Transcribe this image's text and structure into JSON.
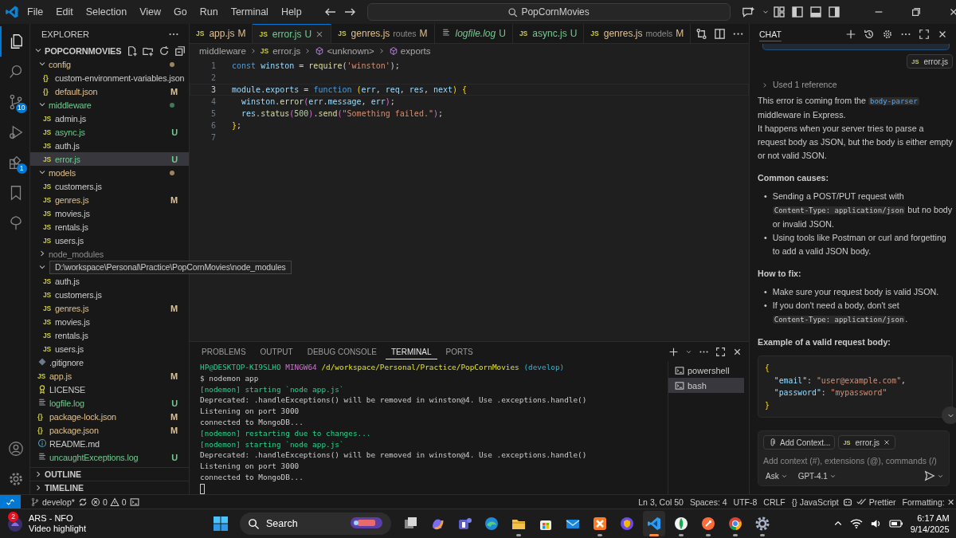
{
  "titlebar": {
    "menu": [
      "File",
      "Edit",
      "Selection",
      "View",
      "Go",
      "Run",
      "Terminal",
      "Help"
    ],
    "search": "PopCornMovies"
  },
  "activity_bar": {
    "items": [
      {
        "kind": "files",
        "selected": true
      },
      {
        "kind": "search",
        "selected": false
      },
      {
        "kind": "source-control",
        "selected": false,
        "badge": "10"
      },
      {
        "kind": "run",
        "selected": false
      },
      {
        "kind": "extensions",
        "selected": false,
        "badge": "1"
      },
      {
        "kind": "bookmark",
        "selected": false
      },
      {
        "kind": "tree",
        "selected": false
      }
    ],
    "bottom": [
      {
        "kind": "account"
      },
      {
        "kind": "settings"
      }
    ]
  },
  "explorer": {
    "title": "EXPLORER",
    "root": {
      "label": "POPCORNMOVIES",
      "expanded": true,
      "children": [
        {
          "kind": "folder",
          "label": "config",
          "modified": true,
          "untracked": false,
          "ignored": false,
          "expanded": true,
          "selected": false,
          "children": [
            {
              "kind": "json",
              "icon": "{}",
              "label": "custom-environment-variables.json",
              "modified": false,
              "untracked": false,
              "selected": false
            },
            {
              "kind": "json",
              "icon": "{}",
              "label": "default.json",
              "modified": true,
              "untracked": false,
              "badge": "M",
              "selected": false
            }
          ]
        },
        {
          "kind": "folder",
          "label": "middleware",
          "modified": false,
          "untracked": true,
          "ignored": false,
          "expanded": true,
          "selected": false,
          "children": [
            {
              "kind": "js",
              "icon": "JS",
              "label": "admin.js",
              "modified": false,
              "untracked": false,
              "selected": false
            },
            {
              "kind": "js",
              "icon": "JS",
              "label": "async.js",
              "modified": false,
              "untracked": true,
              "badge": "U",
              "selected": false
            },
            {
              "kind": "js",
              "icon": "JS",
              "label": "auth.js",
              "modified": false,
              "untracked": false,
              "selected": false
            },
            {
              "kind": "js",
              "icon": "JS",
              "label": "error.js",
              "modified": false,
              "untracked": true,
              "badge": "U",
              "selected": true
            }
          ]
        },
        {
          "kind": "folder",
          "label": "models",
          "modified": true,
          "untracked": false,
          "ignored": false,
          "expanded": true,
          "selected": false,
          "children": [
            {
              "kind": "js",
              "icon": "JS",
              "label": "customers.js",
              "modified": false,
              "untracked": false,
              "selected": false
            },
            {
              "kind": "js",
              "icon": "JS",
              "label": "genres.js",
              "modified": true,
              "untracked": false,
              "badge": "M",
              "selected": false
            },
            {
              "kind": "js",
              "icon": "JS",
              "label": "movies.js",
              "modified": false,
              "untracked": false,
              "selected": false
            },
            {
              "kind": "js",
              "icon": "JS",
              "label": "rentals.js",
              "modified": false,
              "untracked": false,
              "selected": false
            },
            {
              "kind": "js",
              "icon": "JS",
              "label": "users.js",
              "modified": false,
              "untracked": false,
              "selected": false
            }
          ]
        },
        {
          "kind": "folder",
          "label": "node_modules",
          "modified": false,
          "untracked": false,
          "ignored": true,
          "expanded": false,
          "selected": false
        },
        {
          "kind": "folder",
          "tooltip": "D:\\workspace\\Personal\\Practice\\PopCornMovies\\node_modules",
          "modified": false,
          "untracked": false,
          "ignored": false,
          "expanded": true,
          "selected": false,
          "children": [
            {
              "kind": "js",
              "icon": "JS",
              "label": "auth.js",
              "modified": false,
              "untracked": false,
              "selected": false
            },
            {
              "kind": "js",
              "icon": "JS",
              "label": "customers.js",
              "modified": false,
              "untracked": false,
              "selected": false
            },
            {
              "kind": "js",
              "icon": "JS",
              "label": "genres.js",
              "modified": true,
              "untracked": false,
              "badge": "M",
              "selected": false
            },
            {
              "kind": "js",
              "icon": "JS",
              "label": "movies.js",
              "modified": false,
              "untracked": false,
              "selected": false
            },
            {
              "kind": "js",
              "icon": "JS",
              "label": "rentals.js",
              "modified": false,
              "untracked": false,
              "selected": false
            },
            {
              "kind": "js",
              "icon": "JS",
              "label": "users.js",
              "modified": false,
              "untracked": false,
              "selected": false
            }
          ]
        },
        {
          "kind": "git",
          "label": ".gitignore",
          "modified": false,
          "untracked": false,
          "ignored": false,
          "selected": false
        },
        {
          "kind": "js",
          "icon": "JS",
          "label": "app.js",
          "modified": true,
          "untracked": false,
          "ignored": false,
          "badge": "M",
          "selected": false
        },
        {
          "kind": "license",
          "label": "LICENSE",
          "modified": false,
          "untracked": false,
          "ignored": false,
          "selected": false
        },
        {
          "kind": "log",
          "label": "logfile.log",
          "modified": false,
          "untracked": true,
          "ignored": false,
          "badge": "U",
          "selected": false
        },
        {
          "kind": "json",
          "icon": "{}",
          "label": "package-lock.json",
          "modified": true,
          "untracked": false,
          "ignored": false,
          "badge": "M",
          "selected": false
        },
        {
          "kind": "json",
          "icon": "{}",
          "label": "package.json",
          "modified": true,
          "untracked": false,
          "ignored": false,
          "badge": "M",
          "selected": false
        },
        {
          "kind": "info",
          "label": "README.md",
          "modified": false,
          "untracked": false,
          "ignored": false,
          "selected": false
        },
        {
          "kind": "log",
          "label": "uncaughtExceptions.log",
          "modified": false,
          "untracked": true,
          "ignored": false,
          "badge": "U",
          "selected": false
        }
      ]
    },
    "sections": [
      "OUTLINE",
      "TIMELINE"
    ]
  },
  "tabs": [
    {
      "kind": "js",
      "icon": "JS",
      "label": "app.js",
      "modified": true,
      "untracked": false,
      "badge": "M",
      "selected": false,
      "preview": false
    },
    {
      "kind": "js",
      "icon": "JS",
      "label": "error.js",
      "modified": false,
      "untracked": true,
      "badge": "U",
      "selected": true,
      "preview": false
    },
    {
      "kind": "js",
      "icon": "JS",
      "label": "genres.js",
      "description": "routes",
      "modified": true,
      "untracked": false,
      "badge": "M",
      "selected": false,
      "preview": false
    },
    {
      "kind": "log",
      "label": "logfile.log",
      "modified": false,
      "untracked": true,
      "badge": "U",
      "selected": false,
      "preview": true
    },
    {
      "kind": "js",
      "icon": "JS",
      "label": "async.js",
      "modified": false,
      "untracked": true,
      "badge": "U",
      "selected": false,
      "preview": false
    },
    {
      "kind": "js",
      "icon": "JS",
      "label": "genres.js",
      "description": "models",
      "modified": true,
      "untracked": false,
      "badge": "M",
      "selected": false,
      "preview": false
    }
  ],
  "breadcrumbs": [
    {
      "kind": "folder",
      "label": "middleware"
    },
    {
      "kind": "file",
      "icon": "JS",
      "label": "error.js"
    },
    {
      "kind": "symbol",
      "label": "<unknown>"
    },
    {
      "kind": "symbol",
      "label": "exports"
    }
  ],
  "code": [
    {
      "number": "1",
      "current": false,
      "tokens": [
        {
          "kind": "kw",
          "text": "const "
        },
        {
          "kind": "var",
          "text": "winston"
        },
        {
          "kind": "p",
          "text": " = "
        },
        {
          "kind": "fn",
          "text": "require"
        },
        {
          "kind": "p",
          "text": "("
        },
        {
          "kind": "str",
          "text": "'winston'"
        },
        {
          "kind": "p",
          "text": ");"
        }
      ]
    },
    {
      "number": "2",
      "current": false
    },
    {
      "number": "3",
      "current": true,
      "tokens": [
        {
          "kind": "var",
          "text": "module"
        },
        {
          "kind": "p",
          "text": "."
        },
        {
          "kind": "var",
          "text": "exports"
        },
        {
          "kind": "p",
          "text": " = "
        },
        {
          "kind": "kw",
          "text": "function "
        },
        {
          "kind": "br",
          "text": "("
        },
        {
          "kind": "var",
          "text": "err"
        },
        {
          "kind": "p",
          "text": ", "
        },
        {
          "kind": "var",
          "text": "req"
        },
        {
          "kind": "p",
          "text": ", "
        },
        {
          "kind": "var",
          "text": "res"
        },
        {
          "kind": "p",
          "text": ", "
        },
        {
          "kind": "var",
          "text": "next"
        },
        {
          "kind": "br",
          "text": ")"
        },
        {
          "kind": "br",
          "text": " {"
        }
      ]
    },
    {
      "number": "4",
      "current": false,
      "tokens": [
        {
          "kind": "var",
          "text": "  winston"
        },
        {
          "kind": "p",
          "text": "."
        },
        {
          "kind": "fn",
          "text": "error"
        },
        {
          "kind": "br2",
          "text": "("
        },
        {
          "kind": "var",
          "text": "err"
        },
        {
          "kind": "p",
          "text": "."
        },
        {
          "kind": "var",
          "text": "message"
        },
        {
          "kind": "p",
          "text": ", "
        },
        {
          "kind": "var",
          "text": "err"
        },
        {
          "kind": "br2",
          "text": ")"
        },
        {
          "kind": "p",
          "text": ";"
        }
      ]
    },
    {
      "number": "5",
      "current": false,
      "tokens": [
        {
          "kind": "var",
          "text": "  res"
        },
        {
          "kind": "p",
          "text": "."
        },
        {
          "kind": "fn",
          "text": "status"
        },
        {
          "kind": "br2",
          "text": "("
        },
        {
          "kind": "num",
          "text": "500"
        },
        {
          "kind": "br2",
          "text": ")"
        },
        {
          "kind": "p",
          "text": "."
        },
        {
          "kind": "fn",
          "text": "send"
        },
        {
          "kind": "br2",
          "text": "("
        },
        {
          "kind": "str",
          "text": "\"Something failed.\""
        },
        {
          "kind": "br2",
          "text": ")"
        },
        {
          "kind": "p",
          "text": ";"
        }
      ]
    },
    {
      "number": "6",
      "current": false,
      "tokens": [
        {
          "kind": "br",
          "text": "}"
        },
        {
          "kind": "p",
          "text": ";"
        }
      ]
    },
    {
      "number": "7",
      "current": false
    }
  ],
  "panel": {
    "tabs": [
      {
        "label": "PROBLEMS",
        "selected": false
      },
      {
        "label": "OUTPUT",
        "selected": false
      },
      {
        "label": "DEBUG CONSOLE",
        "selected": false
      },
      {
        "label": "TERMINAL",
        "selected": true
      },
      {
        "label": "PORTS",
        "selected": false
      }
    ],
    "terminal_lines": [
      [
        {
          "kind": "user",
          "text": "HP@DESKTOP-KI9SLHO"
        },
        {
          "kind": "sys",
          "text": " MINGW64"
        },
        {
          "kind": "path",
          "text": " /d/workspace/Personal/Practice/PopCornMovies"
        },
        {
          "kind": "branch",
          "text": " (develop)"
        }
      ],
      [
        {
          "kind": "plain",
          "text": "$ nodemon app"
        }
      ],
      [
        {
          "kind": "green",
          "text": "[nodemon] starting `node app.js`"
        }
      ],
      [
        {
          "kind": "plain",
          "text": "Deprecated: .handleExceptions() will be removed in winston@4. Use .exceptions.handle()"
        }
      ],
      [
        {
          "kind": "plain",
          "text": "Listening on port 3000"
        }
      ],
      [
        {
          "kind": "plain",
          "text": "connected to MongoDB..."
        }
      ],
      [
        {
          "kind": "green",
          "text": "[nodemon] restarting due to changes..."
        }
      ],
      [
        {
          "kind": "green",
          "text": "[nodemon] starting `node app.js`"
        }
      ],
      [
        {
          "kind": "plain",
          "text": "Deprecated: .handleExceptions() will be removed in winston@4. Use .exceptions.handle()"
        }
      ],
      [
        {
          "kind": "plain",
          "text": "Listening on port 3000"
        }
      ],
      [
        {
          "kind": "plain",
          "text": "connected to MongoDB..."
        }
      ]
    ],
    "terminals": [
      {
        "label": "powershell",
        "selected": false
      },
      {
        "label": "bash",
        "selected": true
      }
    ]
  },
  "chat": {
    "title": "CHAT",
    "reference_chip": {
      "icon": "JS",
      "label": "error.js"
    },
    "references": "Used 1 reference",
    "blocks": [
      {
        "kind": "paragraph",
        "parts": [
          {
            "kind": "text",
            "text": "This error is coming from the "
          },
          {
            "kind": "code",
            "text": "body-parser"
          },
          {
            "kind": "text",
            "text": " middleware in Express."
          }
        ]
      },
      {
        "kind": "paragraph",
        "parts": [
          {
            "kind": "text",
            "text": "It happens when your server tries to parse a request body as JSON, but the body is either empty or not valid JSON."
          }
        ]
      },
      {
        "kind": "heading",
        "text": "Common causes:"
      },
      {
        "kind": "list",
        "items": [
          {
            "marker": "•",
            "parts": [
              {
                "kind": "text",
                "text": "Sending a POST/PUT request with "
              },
              {
                "kind": "code",
                "text": "Content-Type: application/json"
              },
              {
                "kind": "text",
                "text": " but no body or invalid JSON."
              }
            ]
          },
          {
            "marker": "•",
            "parts": [
              {
                "kind": "text",
                "text": "Using tools like Postman or curl and forgetting to add a valid JSON body."
              }
            ]
          }
        ]
      },
      {
        "kind": "heading",
        "text": "How to fix:"
      },
      {
        "kind": "list",
        "items": [
          {
            "marker": "•",
            "parts": [
              {
                "kind": "text",
                "text": "Make sure your request body is valid JSON."
              }
            ]
          },
          {
            "marker": "•",
            "parts": [
              {
                "kind": "text",
                "text": "If you don't need a body, don't set "
              },
              {
                "kind": "code",
                "text": "Content-Type: application/json"
              },
              {
                "kind": "text",
                "text": "."
              }
            ]
          }
        ]
      },
      {
        "kind": "heading",
        "text": "Example of a valid request body:"
      },
      {
        "kind": "codeblock",
        "lines": [
          [
            {
              "kind": "br",
              "text": "{"
            }
          ],
          [
            {
              "kind": "key",
              "text": "  \"email\""
            },
            {
              "kind": "p",
              "text": ": "
            },
            {
              "kind": "str",
              "text": "\"user@example.com\""
            },
            {
              "kind": "p",
              "text": ","
            }
          ],
          [
            {
              "kind": "key",
              "text": "  \"password\""
            },
            {
              "kind": "p",
              "text": ": "
            },
            {
              "kind": "str",
              "text": "\"mypassword\""
            }
          ],
          [
            {
              "kind": "br",
              "text": "}"
            }
          ]
        ]
      }
    ],
    "input": {
      "chips": [
        {
          "kind": "attach",
          "label": "Add Context..."
        },
        {
          "kind": "file",
          "icon": "JS",
          "label": "error.js"
        }
      ],
      "placeholder": "Add context (#), extensions (@), commands (/)",
      "mode": "Ask",
      "model": "GPT-4.1"
    }
  },
  "status_bar": {
    "branch": "develop*",
    "errors": "0",
    "warnings": "0",
    "right": [
      "Ln 3, Col 50",
      "Spaces: 4",
      "UTF-8",
      "CRLF",
      "{} JavaScript"
    ],
    "prettier": "Prettier",
    "formatting": "Formatting: ✕"
  },
  "taskbar": {
    "notification": {
      "badge": "2",
      "title": "ARS - NFO",
      "subtitle": "Video highlight"
    },
    "search": "Search",
    "apps": [
      {
        "kind": "taskview",
        "running": false,
        "active": false
      },
      {
        "kind": "copilot",
        "running": false,
        "active": false
      },
      {
        "kind": "teams",
        "running": false,
        "active": false
      },
      {
        "kind": "edge",
        "running": false,
        "active": false
      },
      {
        "kind": "files",
        "running": true,
        "active": false
      },
      {
        "kind": "store",
        "running": false,
        "active": false
      },
      {
        "kind": "mail",
        "running": false,
        "active": false
      },
      {
        "kind": "xampp",
        "running": true,
        "active": false
      },
      {
        "kind": "vpn",
        "running": false,
        "active": false
      },
      {
        "kind": "vscode",
        "running": true,
        "active": true
      },
      {
        "kind": "mongodb",
        "running": true,
        "active": false
      },
      {
        "kind": "postman",
        "running": true,
        "active": false
      },
      {
        "kind": "chrome",
        "running": true,
        "active": false
      },
      {
        "kind": "settings",
        "running": true,
        "active": false
      }
    ],
    "time": "6:17 AM",
    "date": "9/14/2025"
  }
}
